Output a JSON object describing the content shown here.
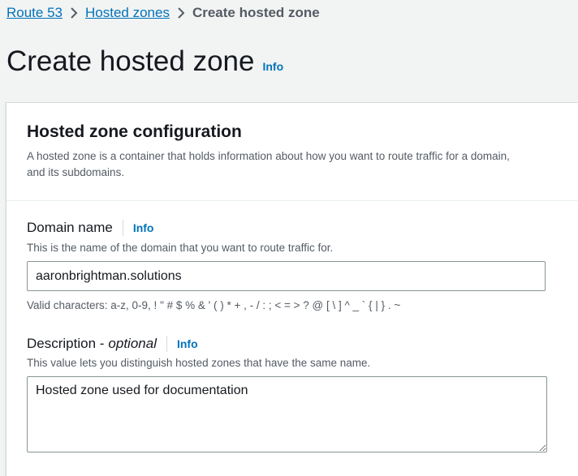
{
  "breadcrumb": {
    "items": [
      "Route 53",
      "Hosted zones"
    ],
    "current": "Create hosted zone"
  },
  "page": {
    "title": "Create hosted zone",
    "info": "Info"
  },
  "panel": {
    "title": "Hosted zone configuration",
    "description_line1": "A hosted zone is a container that holds information about how you want to route traffic for a domain,",
    "description_line2": "and its subdomains."
  },
  "domain_name": {
    "label": "Domain name",
    "info": "Info",
    "description": "This is the name of the domain that you want to route traffic for.",
    "value": "aaronbrightman.solutions",
    "constraint": "Valid characters: a-z, 0-9, ! \" # $ % & ' ( ) * + , - / : ; < = > ? @ [ \\ ] ^ _ ` { | } . ~"
  },
  "description_field": {
    "label": "Description -",
    "optional": "optional",
    "info": "Info",
    "description": "This value lets you distinguish hosted zones that have the same name.",
    "value": "Hosted zone used for documentation"
  },
  "colors": {
    "link": "#0073bb",
    "text": "#16191f",
    "secondary_text": "#545b64",
    "background": "#f2f3f3"
  }
}
